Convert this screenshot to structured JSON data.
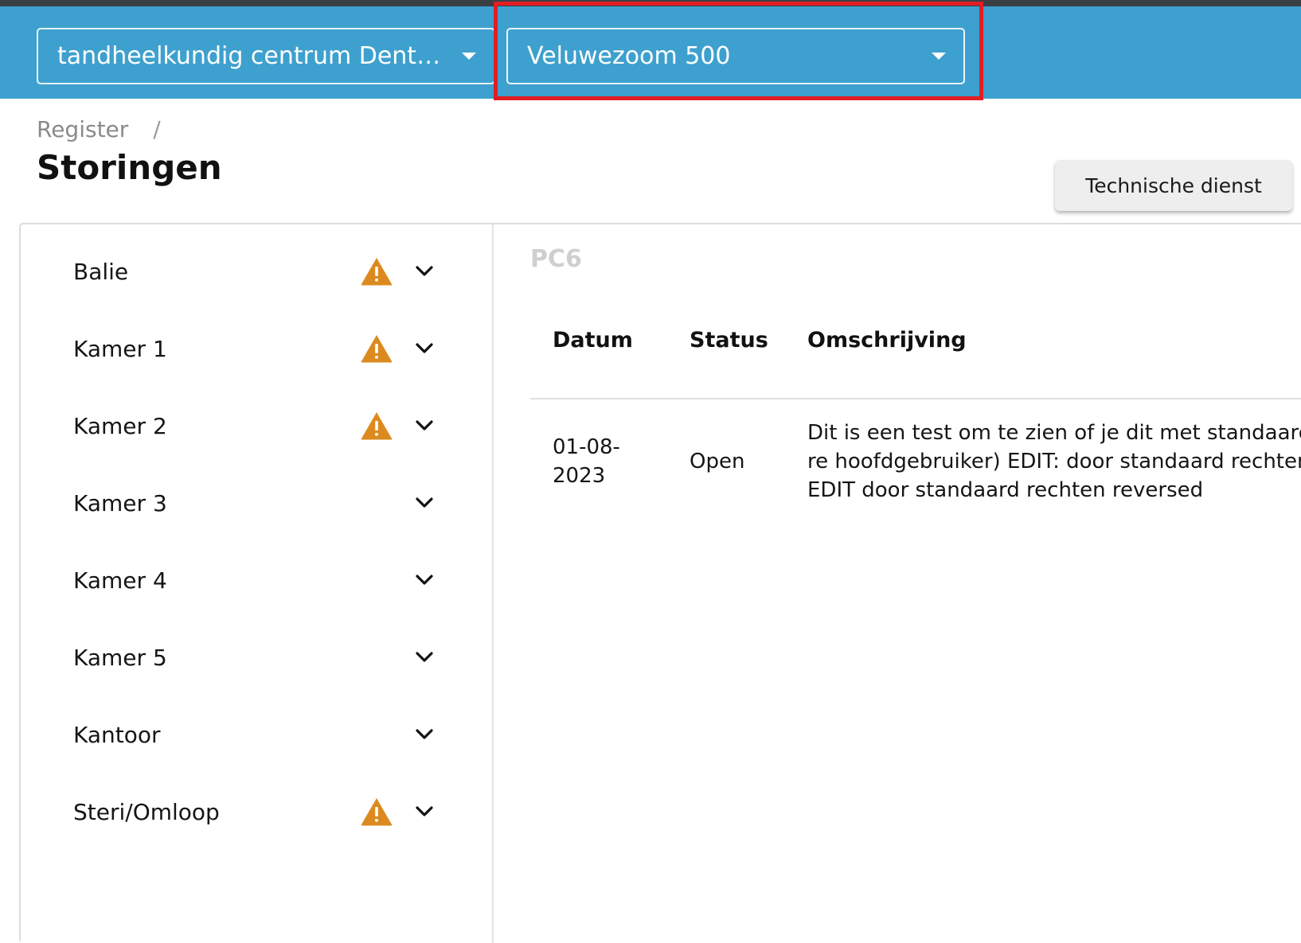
{
  "header": {
    "practice_select": "tandheelkundig centrum Denta...",
    "location_select": "Veluwezoom 500"
  },
  "breadcrumb": {
    "parent": "Register",
    "separator": "/"
  },
  "page_title": "Storingen",
  "technical_service_button": "Technische dienst",
  "rooms": [
    {
      "label": "Balie",
      "warning": true
    },
    {
      "label": "Kamer 1",
      "warning": true
    },
    {
      "label": "Kamer 2",
      "warning": true
    },
    {
      "label": "Kamer 3",
      "warning": false
    },
    {
      "label": "Kamer 4",
      "warning": false
    },
    {
      "label": "Kamer 5",
      "warning": false
    },
    {
      "label": "Kantoor",
      "warning": false
    },
    {
      "label": "Steri/Omloop",
      "warning": true
    }
  ],
  "detail": {
    "title": "PC6",
    "columns": {
      "date": "Datum",
      "status": "Status",
      "description": "Omschrijving"
    },
    "rows": [
      {
        "date": "01-08-2023",
        "status": "Open",
        "description": "Dit is een test om te zien of je dit met standaard re hoofdgebruiker) EDIT: door standaard rechten EDIT door standaard rechten reversed"
      }
    ]
  },
  "colors": {
    "header_bg": "#3ea0ce",
    "warning": "#dc8a1f",
    "highlight": "#e01e24"
  }
}
